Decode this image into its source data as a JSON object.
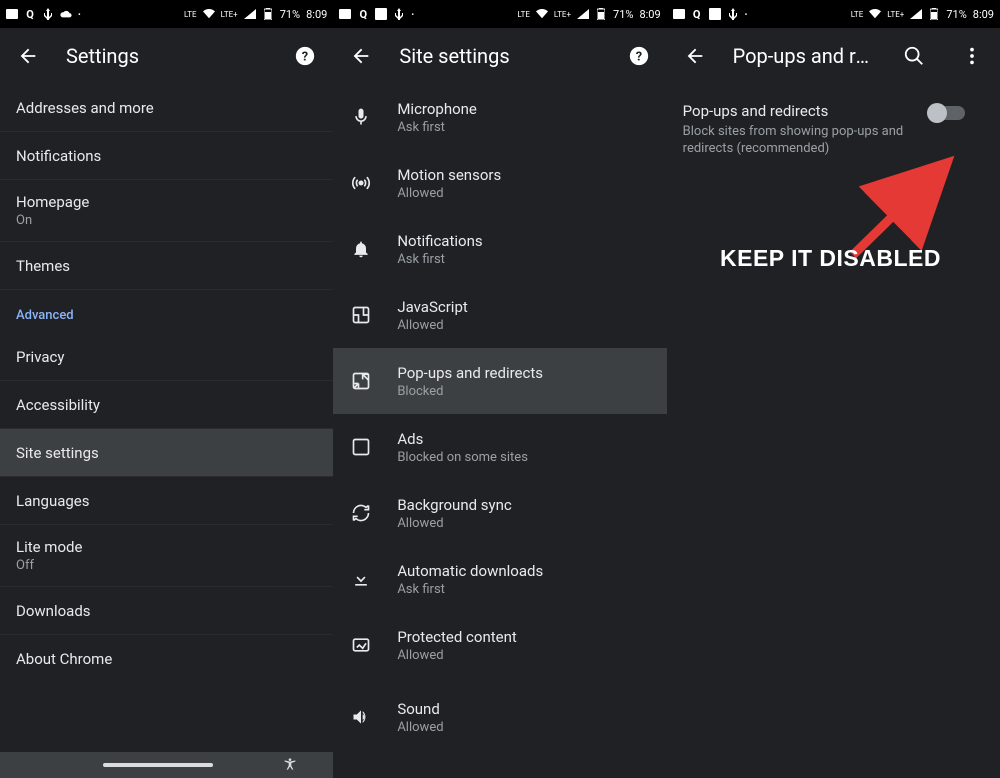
{
  "status": {
    "battery": "71%",
    "time": "8:09"
  },
  "panel1": {
    "title": "Settings",
    "items": [
      {
        "title": "Addresses and more",
        "sub": ""
      },
      {
        "title": "Notifications",
        "sub": ""
      },
      {
        "title": "Homepage",
        "sub": "On"
      },
      {
        "title": "Themes",
        "sub": ""
      }
    ],
    "section_label": "Advanced",
    "items2": [
      {
        "title": "Privacy",
        "sub": ""
      },
      {
        "title": "Accessibility",
        "sub": ""
      },
      {
        "title": "Site settings",
        "sub": "",
        "selected": true
      },
      {
        "title": "Languages",
        "sub": ""
      },
      {
        "title": "Lite mode",
        "sub": "Off"
      },
      {
        "title": "Downloads",
        "sub": ""
      },
      {
        "title": "About Chrome",
        "sub": ""
      }
    ]
  },
  "panel2": {
    "title": "Site settings",
    "items": [
      {
        "title": "Microphone",
        "sub": "Ask first",
        "icon": "mic"
      },
      {
        "title": "Motion sensors",
        "sub": "Allowed",
        "icon": "sensors"
      },
      {
        "title": "Notifications",
        "sub": "Ask first",
        "icon": "bell"
      },
      {
        "title": "JavaScript",
        "sub": "Allowed",
        "icon": "js"
      },
      {
        "title": "Pop-ups and redirects",
        "sub": "Blocked",
        "icon": "popups",
        "highlight": true
      },
      {
        "title": "Ads",
        "sub": "Blocked on some sites",
        "icon": "ads"
      },
      {
        "title": "Background sync",
        "sub": "Allowed",
        "icon": "sync"
      },
      {
        "title": "Automatic downloads",
        "sub": "Ask first",
        "icon": "download"
      },
      {
        "title": "Protected content",
        "sub": "Allowed",
        "icon": "protected"
      },
      {
        "title": "Sound",
        "sub": "Allowed",
        "icon": "sound"
      }
    ]
  },
  "panel3": {
    "title": "Pop-ups and redir...",
    "item": {
      "title": "Pop-ups and redirects",
      "sub": "Block sites from showing pop-ups and redirects (recommended)"
    }
  },
  "annotation": "KEEP IT DISABLED"
}
